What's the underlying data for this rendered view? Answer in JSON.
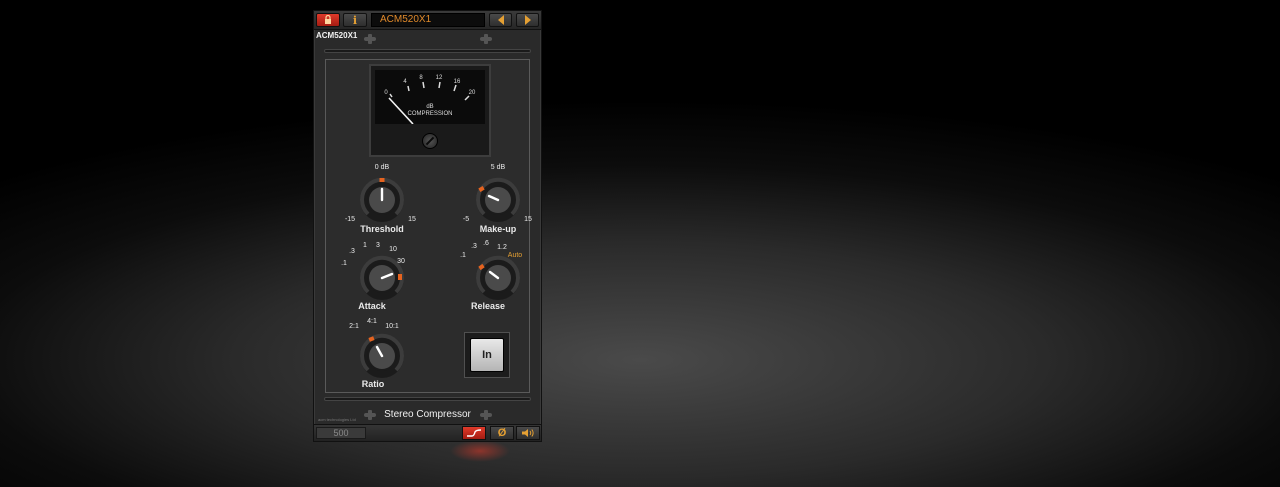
{
  "header": {
    "preset_name": "ACM520X1",
    "icons": {
      "lock": "lock-icon",
      "info": "info-icon",
      "prev": "arrow-left-icon",
      "next": "arrow-right-icon"
    }
  },
  "plugin_name": "ACM520X1",
  "meter": {
    "scale": [
      "0",
      "4",
      "8",
      "12",
      "16",
      "20"
    ],
    "unit": "dB",
    "caption": "COMPRESSION",
    "needle_value_db": 0
  },
  "knobs": {
    "threshold": {
      "label": "Threshold",
      "top": "0 dB",
      "min": "-15",
      "max": "15",
      "value": 0
    },
    "makeup": {
      "label": "Make-up",
      "top": "5 dB",
      "min": "-5",
      "max": "15",
      "value": 0
    },
    "attack": {
      "label": "Attack",
      "ticks": [
        ".1",
        ".3",
        "1",
        "3",
        "10",
        "30"
      ],
      "value": 0.85
    },
    "release": {
      "label": "Release",
      "ticks": [
        ".1",
        ".3",
        ".6",
        "1.2"
      ],
      "auto": "Auto",
      "value": 0.35
    },
    "ratio": {
      "label": "Ratio",
      "ticks": [
        "2:1",
        "4:1",
        "10:1"
      ],
      "value": 0.3
    }
  },
  "in_button": {
    "label": "In",
    "engaged": true
  },
  "footer": {
    "model": "Stereo Compressor",
    "manufacturer": "acm technologies Ltd",
    "slot_label": "500",
    "phase_symbol": "Ø",
    "icons": {
      "curve": "eq-curve-icon",
      "phase": "phase-invert-icon",
      "speaker": "speaker-icon"
    }
  },
  "colors": {
    "accent": "#e5a033",
    "red": "#d8301f",
    "panel": "#2c2c2c"
  }
}
